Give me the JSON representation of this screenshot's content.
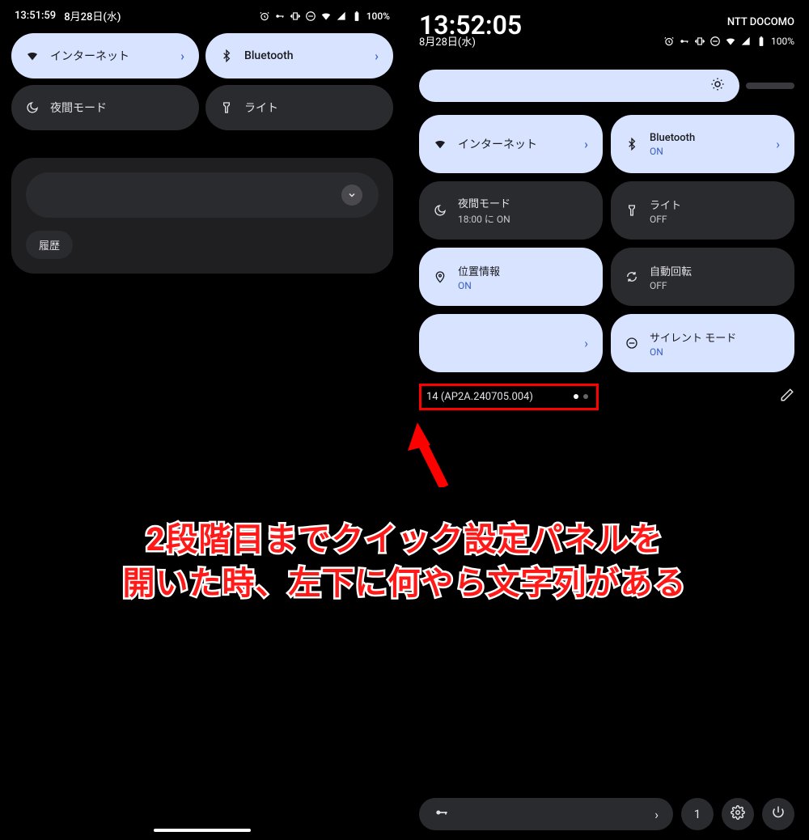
{
  "left": {
    "status": {
      "time": "13:51:59",
      "date": "8月28日(水)",
      "battery": "100%"
    },
    "tiles": {
      "internet": "インターネット",
      "bluetooth": "Bluetooth",
      "night": "夜間モード",
      "light": "ライト"
    },
    "history": "履歴"
  },
  "right": {
    "clock": "13:52:05",
    "carrier": "NTT DOCOMO",
    "date": "8月28日(水)",
    "battery": "100%",
    "tiles": {
      "internet": {
        "label": "インターネット"
      },
      "bluetooth": {
        "label": "Bluetooth",
        "sub": "ON"
      },
      "night": {
        "label": "夜間モード",
        "sub": "18:00 に ON"
      },
      "light": {
        "label": "ライト",
        "sub": "OFF"
      },
      "location": {
        "label": "位置情報",
        "sub": "ON"
      },
      "rotate": {
        "label": "自動回転",
        "sub": "OFF"
      },
      "blank": {
        "label": ""
      },
      "silent": {
        "label": "サイレント モード",
        "sub": "ON"
      }
    },
    "build": "14 (AP2A.240705.004)",
    "user_count": "1"
  },
  "caption_line1": "2段階目までクイック設定パネルを",
  "caption_line2": "開いた時、左下に何やら文字列がある"
}
